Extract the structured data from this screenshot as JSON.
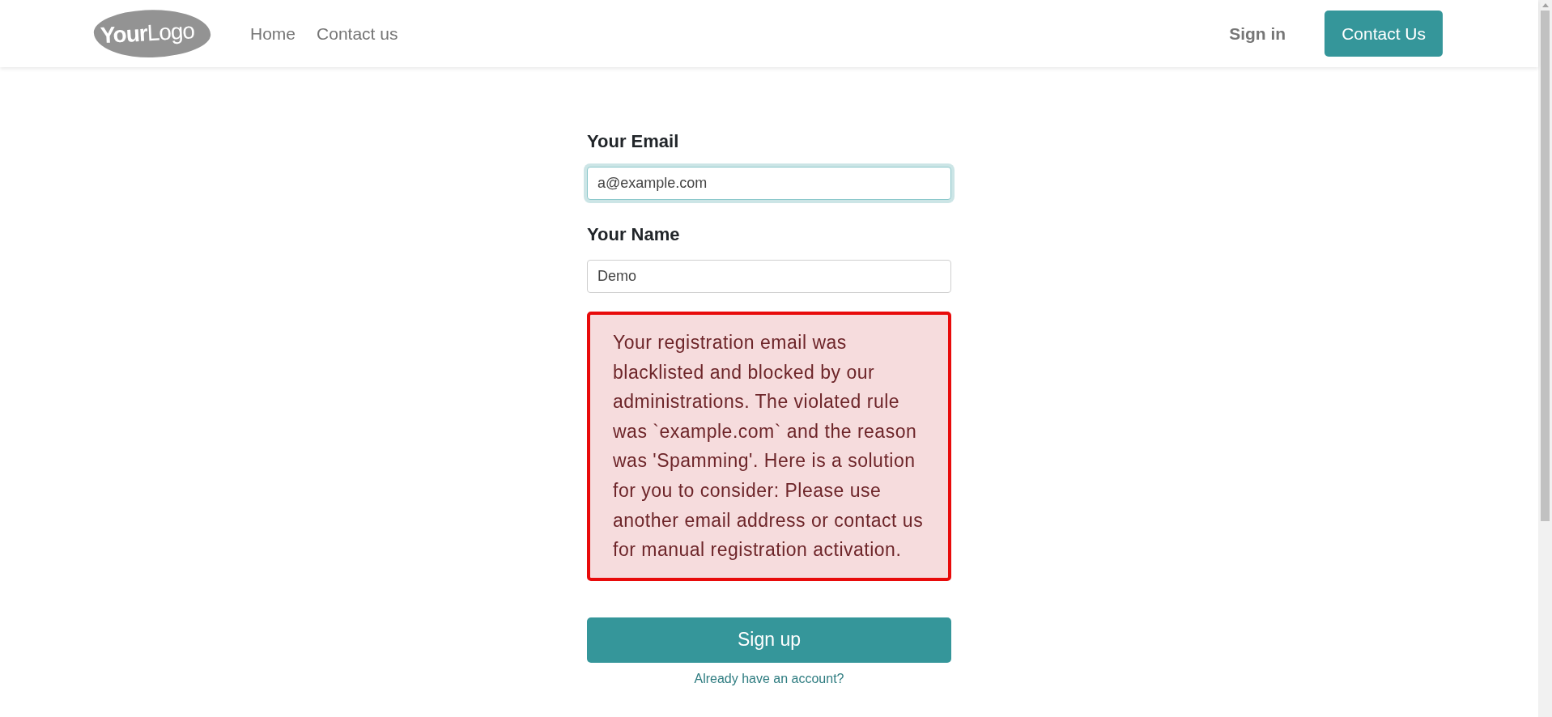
{
  "header": {
    "logo": "**Your**Logo",
    "nav": [
      {
        "label": "Home"
      },
      {
        "label": "Contact us"
      }
    ],
    "sign_in": "Sign in",
    "contact_button": "Contact Us"
  },
  "form": {
    "fields": [
      {
        "label": "Your Email",
        "value": "a@example.com",
        "focused": true
      },
      {
        "label": "Your Name",
        "value": "Demo",
        "focused": false
      }
    ],
    "alert": {
      "kind": "danger",
      "message": "Your registration email was blacklisted and blocked by our administrations. The violated rule was `example.com` and the reason was 'Spamming'. Here is a solution for you to consider: Please use another email address or contact us for manual registration activation."
    },
    "submit": "Sign up",
    "login_link": "Already have an account?"
  }
}
